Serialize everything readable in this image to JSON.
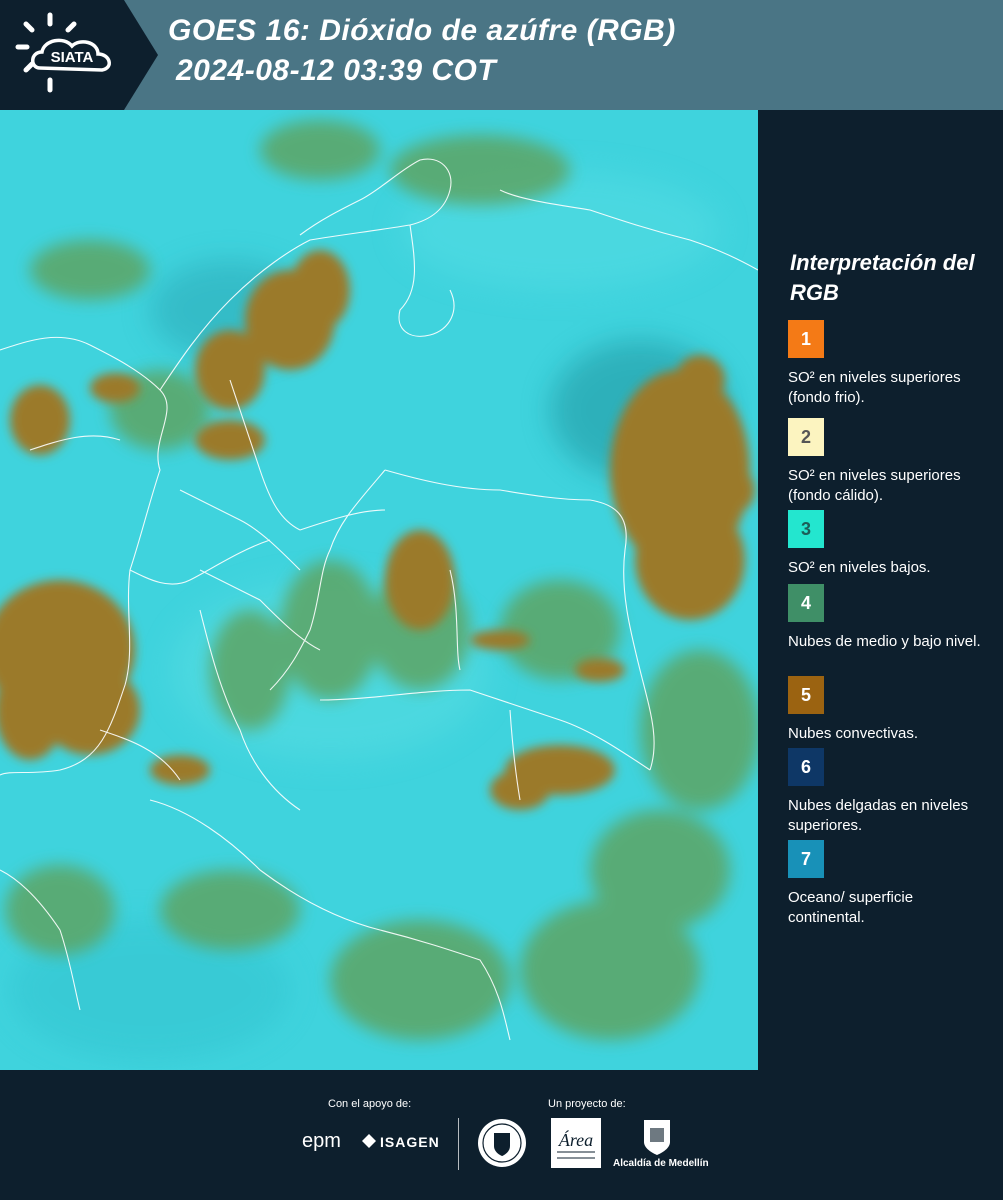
{
  "header": {
    "logo_text": "SIATA",
    "title_line1": "GOES 16: Dióxido de azúfre (RGB)",
    "title_line2": "2024-08-12 03:39 COT"
  },
  "legend": {
    "title": "Interpretación del RGB",
    "items": [
      {
        "number": "1",
        "color": "#f47a16",
        "number_color": "#ffffff",
        "description": "SO² en niveles superiores (fondo frio)."
      },
      {
        "number": "2",
        "color": "#fcf4c0",
        "number_color": "#555555",
        "description": "SO² en niveles superiores (fondo cálido)."
      },
      {
        "number": "3",
        "color": "#23e6cf",
        "number_color": "#1c5e58",
        "description": "SO² en niveles bajos."
      },
      {
        "number": "4",
        "color": "#3f8f67",
        "number_color": "#ffffff",
        "description": "Nubes de medio y bajo nivel."
      },
      {
        "number": "5",
        "color": "#9b6311",
        "number_color": "#ffffff",
        "description": "Nubes convectivas."
      },
      {
        "number": "6",
        "color": "#0e3766",
        "number_color": "#ffffff",
        "description": "Nubes delgadas en niveles superiores."
      },
      {
        "number": "7",
        "color": "#1891b8",
        "number_color": "#ffffff",
        "description": "Oceano/ superficie continental."
      }
    ]
  },
  "footer": {
    "support_label": "Con el apoyo de:",
    "project_label": "Un proyecto de:",
    "sponsors": [
      "epm",
      "ISAGEN"
    ],
    "partners": [
      "Área Metropolitana Valle de Aburrá",
      "Alcaldía de Medellín"
    ]
  },
  "map_colors": {
    "background": "#3fd3dd",
    "convective": "#9b7a2a",
    "midlevel": "#5da565",
    "borders": "#ffffff"
  }
}
